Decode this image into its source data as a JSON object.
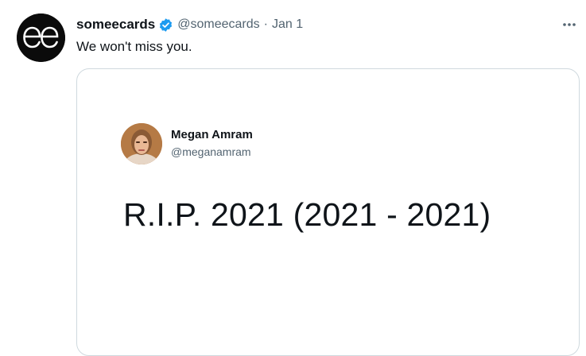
{
  "tweet": {
    "author_name": "someecards",
    "author_handle": "@someecards",
    "separator": "·",
    "date": "Jan 1",
    "text": "We won't miss you.",
    "verified": true,
    "avatar_icon": "someecards-logo-icon",
    "more_icon": "more-options-icon"
  },
  "embedded_tweet": {
    "author_name": "Megan Amram",
    "author_handle": "@meganamram",
    "text": "R.I.P. 2021 (2021 - 2021)",
    "avatar_icon": "profile-photo"
  },
  "colors": {
    "text_primary": "#0f1419",
    "text_secondary": "#536471",
    "verified_blue": "#1d9bf0",
    "border": "#cfd9de",
    "avatar_bg": "#0b0b0b"
  }
}
